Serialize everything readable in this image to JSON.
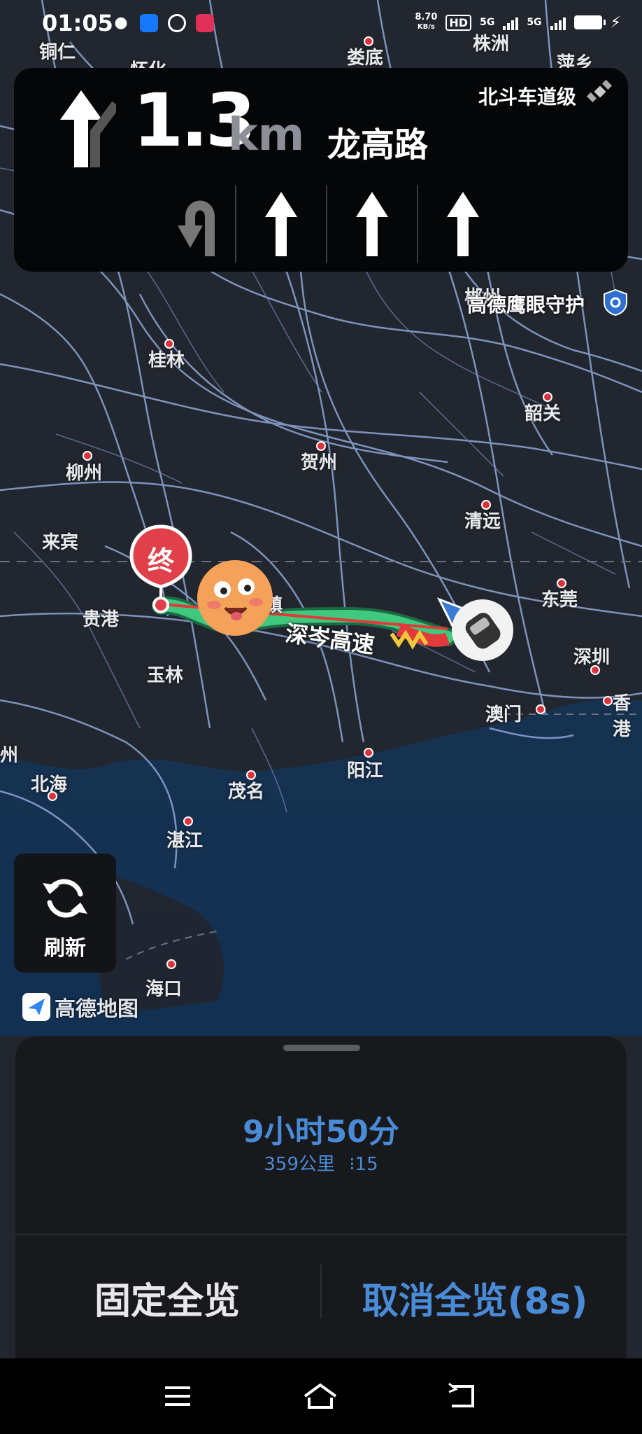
{
  "status_bar": {
    "time": "01:05",
    "net_speed_value": "8.70",
    "net_speed_unit": "KB/s",
    "hd_label": "HD",
    "sig1_label": "5G",
    "sig2_label": "5G",
    "app_icons": [
      "wechat-icon",
      "alipay-icon",
      "link-icon",
      "music-icon"
    ]
  },
  "navigation": {
    "distance_value": "1.3",
    "distance_unit": "km",
    "road_name": "龙高路",
    "lane_level_label": "北斗车道级",
    "lanes": [
      "u-turn-left",
      "straight",
      "straight",
      "straight"
    ]
  },
  "map": {
    "shield_label": "高德鹰眼守护",
    "highway_label": "深岑高速",
    "destination_marker": "终",
    "cities": [
      {
        "name": "铜仁"
      },
      {
        "name": "怀化"
      },
      {
        "name": "娄底"
      },
      {
        "name": "株洲"
      },
      {
        "name": "萍乡"
      },
      {
        "name": "郴州"
      },
      {
        "name": "桂林"
      },
      {
        "name": "韶关"
      },
      {
        "name": "柳州"
      },
      {
        "name": "贺州"
      },
      {
        "name": "清远"
      },
      {
        "name": "来宾"
      },
      {
        "name": "贵港"
      },
      {
        "name": "东莞"
      },
      {
        "name": "玉林"
      },
      {
        "name": "深圳"
      },
      {
        "name": "澳门"
      },
      {
        "name": "香港"
      },
      {
        "name": "州"
      },
      {
        "name": "北海"
      },
      {
        "name": "阳江"
      },
      {
        "name": "茂名"
      },
      {
        "name": "湛江"
      },
      {
        "name": "海口"
      },
      {
        "name": "镇"
      }
    ],
    "logo_text": "高德地图"
  },
  "refresh_button": {
    "label": "刷新"
  },
  "route_summary": {
    "duration": "9小时50分",
    "distance": "359公里",
    "traffic_lights_count": "15"
  },
  "actions": {
    "fix_overview": "固定全览",
    "cancel_overview": "取消全览(8s)"
  },
  "colors": {
    "accent_blue": "#4a8bd8",
    "route_green": "#3fc97e",
    "route_red": "#e23a3a",
    "destination_red": "#e0404a",
    "sea": "#16324f",
    "land": "#22262e",
    "road": "#8fa8d8"
  }
}
